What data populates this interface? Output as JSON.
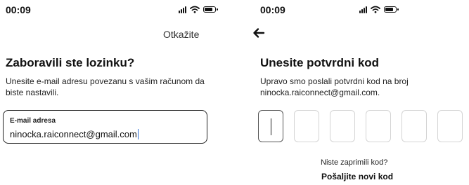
{
  "left_screen": {
    "status_bar": {
      "time": "00:09"
    },
    "cancel_label": "Otkažite",
    "title": "Zaboravili ste lozinku?",
    "description": "Unesite e-mail adresu povezanu s vašim računom da biste nastavili.",
    "email_field": {
      "label": "E-mail adresa",
      "value": "ninocka.raiconnect@gmail.com"
    }
  },
  "right_screen": {
    "status_bar": {
      "time": "00:09"
    },
    "back_icon": "left-arrow-icon",
    "title": "Unesite potvrdni kod",
    "description": "Upravo smo poslali potvrdni kod na broj ninocka.raiconnect@gmail.com.",
    "code_fields": [
      "",
      "",
      "",
      "",
      "",
      ""
    ],
    "resend_question": "Niste zaprimili kod?",
    "resend_link": "Pošaljite novi kod"
  }
}
